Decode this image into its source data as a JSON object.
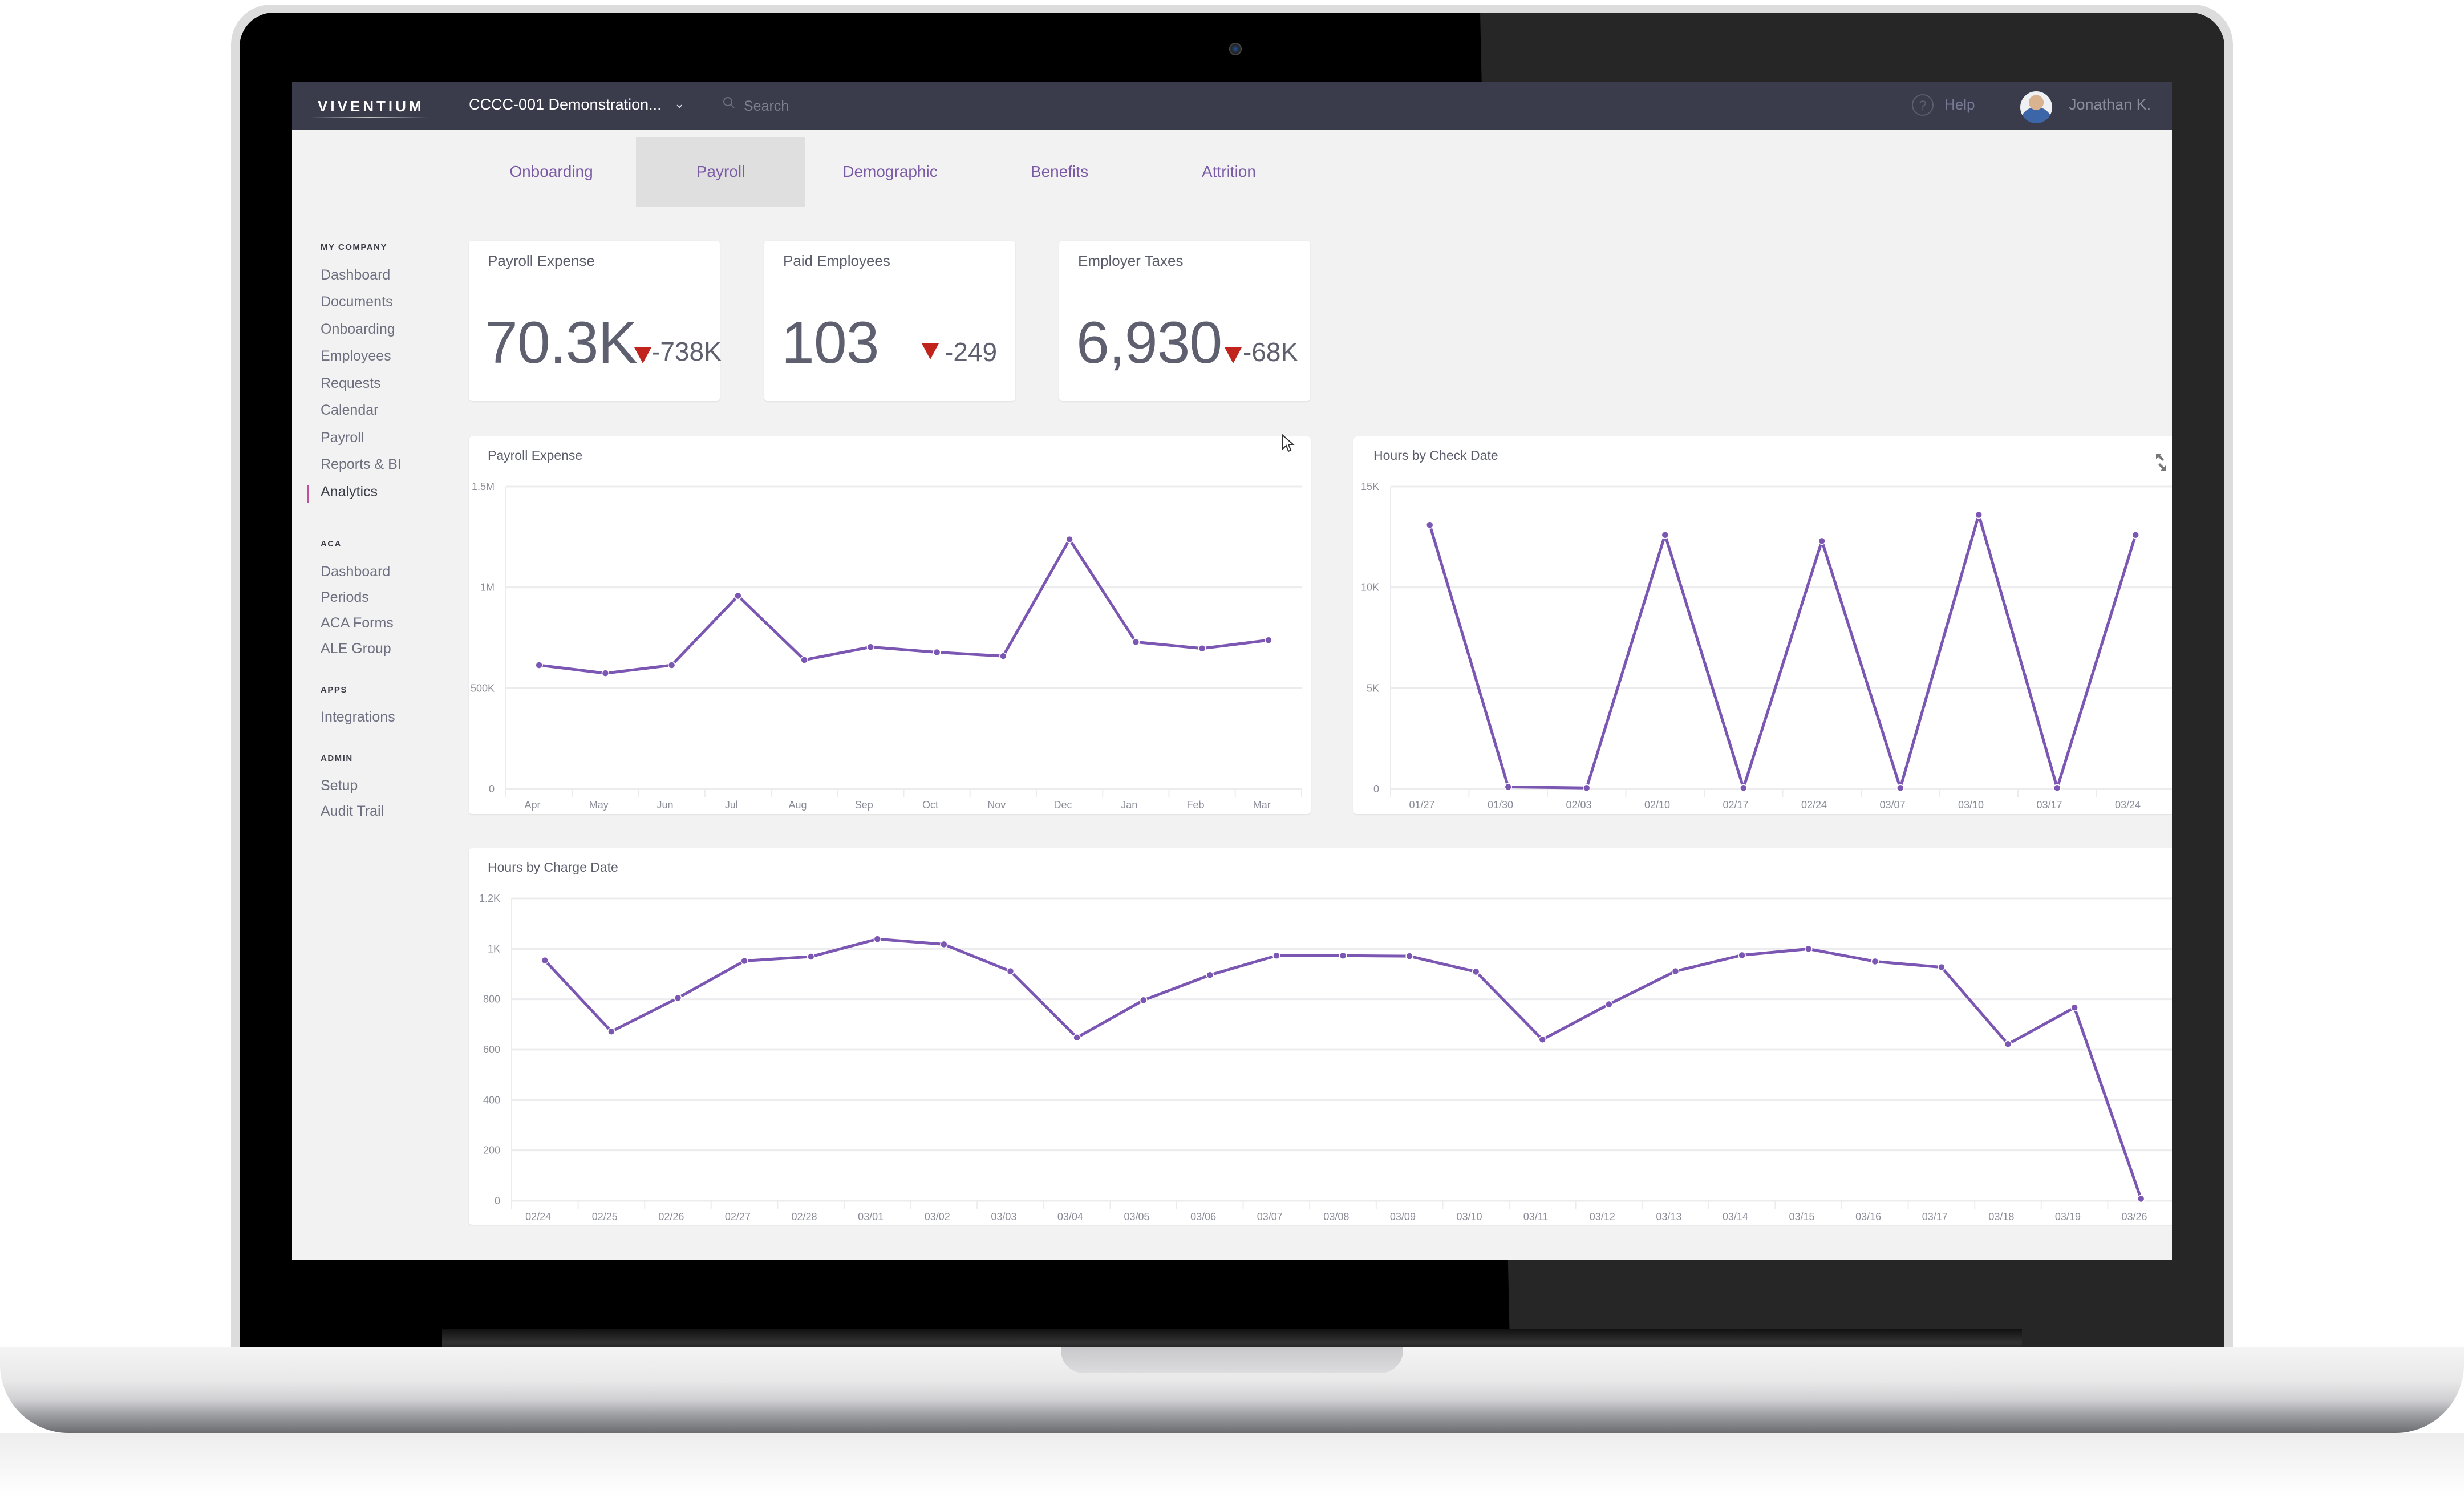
{
  "topbar": {
    "logo": "VIVENTIUM",
    "company": "CCCC-001 Demonstration...",
    "search_placeholder": "Search",
    "help_label": "Help",
    "user_name": "Jonathan K."
  },
  "sidebar": {
    "sections": [
      {
        "heading": "MY COMPANY",
        "items": [
          "Dashboard",
          "Documents",
          "Onboarding",
          "Employees",
          "Requests",
          "Calendar",
          "Payroll",
          "Reports & BI",
          "Analytics"
        ]
      },
      {
        "heading": "ACA",
        "items": [
          "Dashboard",
          "Periods",
          "ACA Forms",
          "ALE Group"
        ]
      },
      {
        "heading": "APPS",
        "items": [
          "Integrations"
        ]
      },
      {
        "heading": "ADMIN",
        "items": [
          "Setup",
          "Audit Trail"
        ]
      }
    ],
    "active_item": "Analytics",
    "accent_color": "#c0509a"
  },
  "tabs": {
    "items": [
      "Onboarding",
      "Payroll",
      "Demographic",
      "Benefits",
      "Attrition"
    ],
    "active": "Payroll"
  },
  "kpis": [
    {
      "title": "Payroll Expense",
      "value": "70.3K",
      "delta": "-738K",
      "trend": "down"
    },
    {
      "title": "Paid Employees",
      "value": "103",
      "delta": "-249",
      "trend": "down"
    },
    {
      "title": "Employer Taxes",
      "value": "6,930",
      "delta": "-68K",
      "trend": "down"
    }
  ],
  "colors": {
    "line": "#7b57b3",
    "down_arrow": "#c0241c",
    "topbar": "#3a3b4b",
    "tab_text": "#7b5aa6"
  },
  "chart_data": [
    {
      "type": "line",
      "title": "Payroll Expense",
      "categories": [
        "Apr",
        "May",
        "Jun",
        "Jul",
        "Aug",
        "Sep",
        "Oct",
        "Nov",
        "Dec",
        "Jan",
        "Feb",
        "Mar"
      ],
      "values": [
        614000,
        574000,
        614000,
        958000,
        640000,
        704000,
        678000,
        659000,
        1238000,
        729000,
        697000,
        738000
      ],
      "yticks": [
        0,
        500000,
        1000000,
        1500000
      ],
      "ytick_labels": [
        "0",
        "500K",
        "1M",
        "1.5M"
      ],
      "ylim": [
        0,
        1500000
      ],
      "xlabel": "",
      "ylabel": "",
      "grid": true
    },
    {
      "type": "line",
      "title": "Hours by Check Date",
      "categories": [
        "01/27",
        "01/30",
        "02/03",
        "02/10",
        "02/17",
        "02/24",
        "03/07",
        "03/10",
        "03/17",
        "03/24"
      ],
      "values": [
        13100,
        100,
        50,
        12600,
        50,
        12300,
        50,
        13600,
        50,
        12600
      ],
      "yticks": [
        0,
        5000,
        10000,
        15000
      ],
      "ytick_labels": [
        "0",
        "5K",
        "10K",
        "15K"
      ],
      "ylim": [
        0,
        15000
      ],
      "xlabel": "",
      "ylabel": "",
      "grid": true
    },
    {
      "type": "line",
      "title": "Hours by Charge Date",
      "categories": [
        "02/24",
        "02/25",
        "02/26",
        "02/27",
        "02/28",
        "03/01",
        "03/02",
        "03/03",
        "03/04",
        "03/05",
        "03/06",
        "03/07",
        "03/08",
        "03/09",
        "03/10",
        "03/11",
        "03/12",
        "03/13",
        "03/14",
        "03/15",
        "03/16",
        "03/17",
        "03/18",
        "03/19",
        "03/26"
      ],
      "values": [
        954,
        672,
        805,
        952,
        969,
        1039,
        1018,
        911,
        648,
        796,
        896,
        973,
        973,
        971,
        909,
        640,
        780,
        911,
        975,
        1000,
        950,
        927,
        622,
        767,
        8
      ],
      "yticks": [
        0,
        200,
        400,
        600,
        800,
        1000,
        1200
      ],
      "ytick_labels": [
        "0",
        "200",
        "400",
        "600",
        "800",
        "1K",
        "1.2K"
      ],
      "ylim": [
        0,
        1200
      ],
      "xlabel": "",
      "ylabel": "",
      "grid": true
    }
  ]
}
